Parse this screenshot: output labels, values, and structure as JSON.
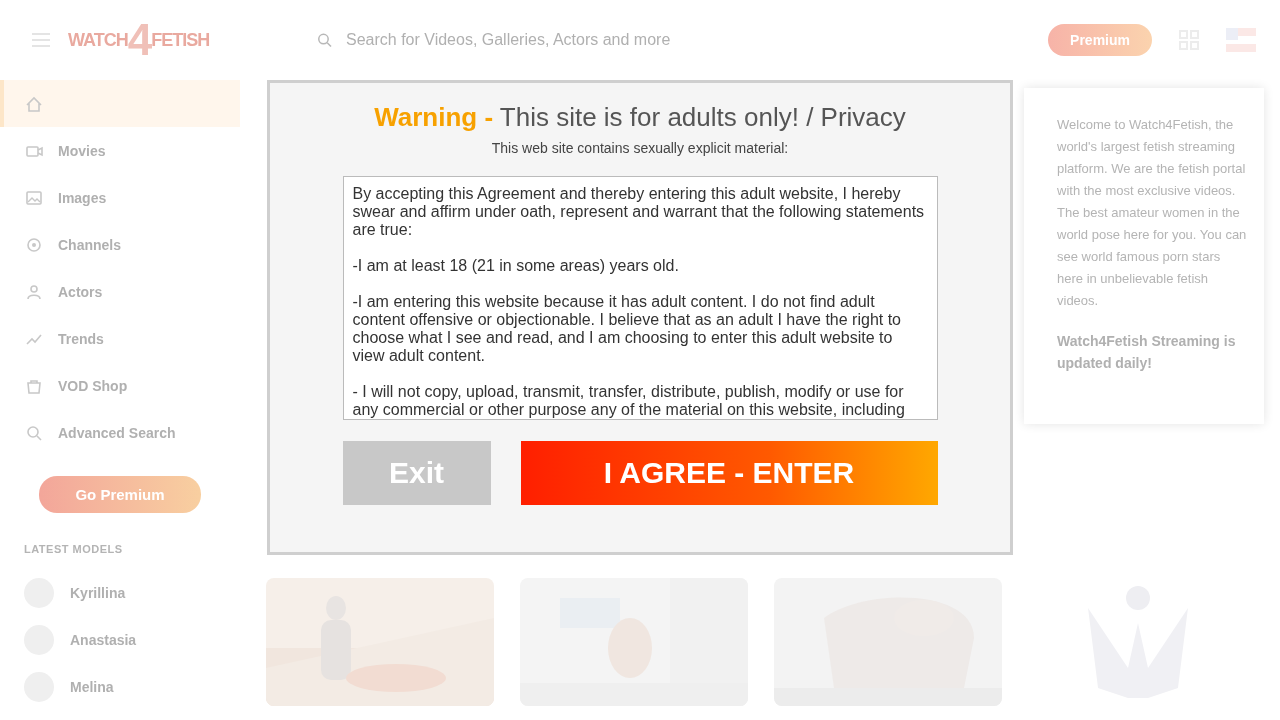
{
  "header": {
    "logo": {
      "left": "WATCH",
      "middle": "4",
      "right": "FETISH"
    },
    "search": {
      "placeholder": "Search for Videos, Galleries, Actors and more"
    },
    "premium_button": "Premium"
  },
  "sidebar": {
    "items": [
      {
        "selected": true
      },
      {
        "label": "Movies",
        "selected": false
      },
      {
        "label": "Images",
        "selected": false
      },
      {
        "label": "Channels",
        "selected": false
      },
      {
        "label": "Actors",
        "selected": false
      },
      {
        "label": "Trends",
        "selected": false
      },
      {
        "label": "VOD Shop",
        "selected": false
      },
      {
        "label": "Advanced Search",
        "selected": false
      }
    ],
    "premium_button": "Go Premium",
    "models_heading": "LATEST MODELS",
    "models": [
      {
        "name": "Kyrillina"
      },
      {
        "name": "Anastasia"
      },
      {
        "name": "Melina"
      }
    ]
  },
  "info_panel": {
    "text": "Welcome to Watch4Fetish, the world's largest fetish streaming platform. We are the fetish portal with the most exclusive videos. The best amateur women in the world pose here for you. You can see world famous porn stars here in unbelievable fetish videos.",
    "update_note": "Watch4Fetish Streaming is updated daily!"
  },
  "dialog": {
    "title_highlight": "Warning -",
    "title": "This site is for adults only! / Privacy",
    "subtitle": "This web site contains sexually explicit material:",
    "agreement": [
      "By accepting this Agreement and thereby entering this adult website, I hereby swear and affirm under oath, represent and warrant that the following statements are true:",
      "-I am at least 18 (21 in some areas) years old.",
      "-I am entering this website because it has adult content. I do not find adult content offensive or objectionable. I believe that as an adult I have the right to choose what I see and read, and I am choosing to enter this adult website to view adult content.",
      "- I will not copy, upload, transmit, transfer, distribute, publish, modify or use for any commercial or other purpose any of the material on this website, including"
    ],
    "exit_button": "Exit",
    "enter_button": "I AGREE - ENTER"
  }
}
